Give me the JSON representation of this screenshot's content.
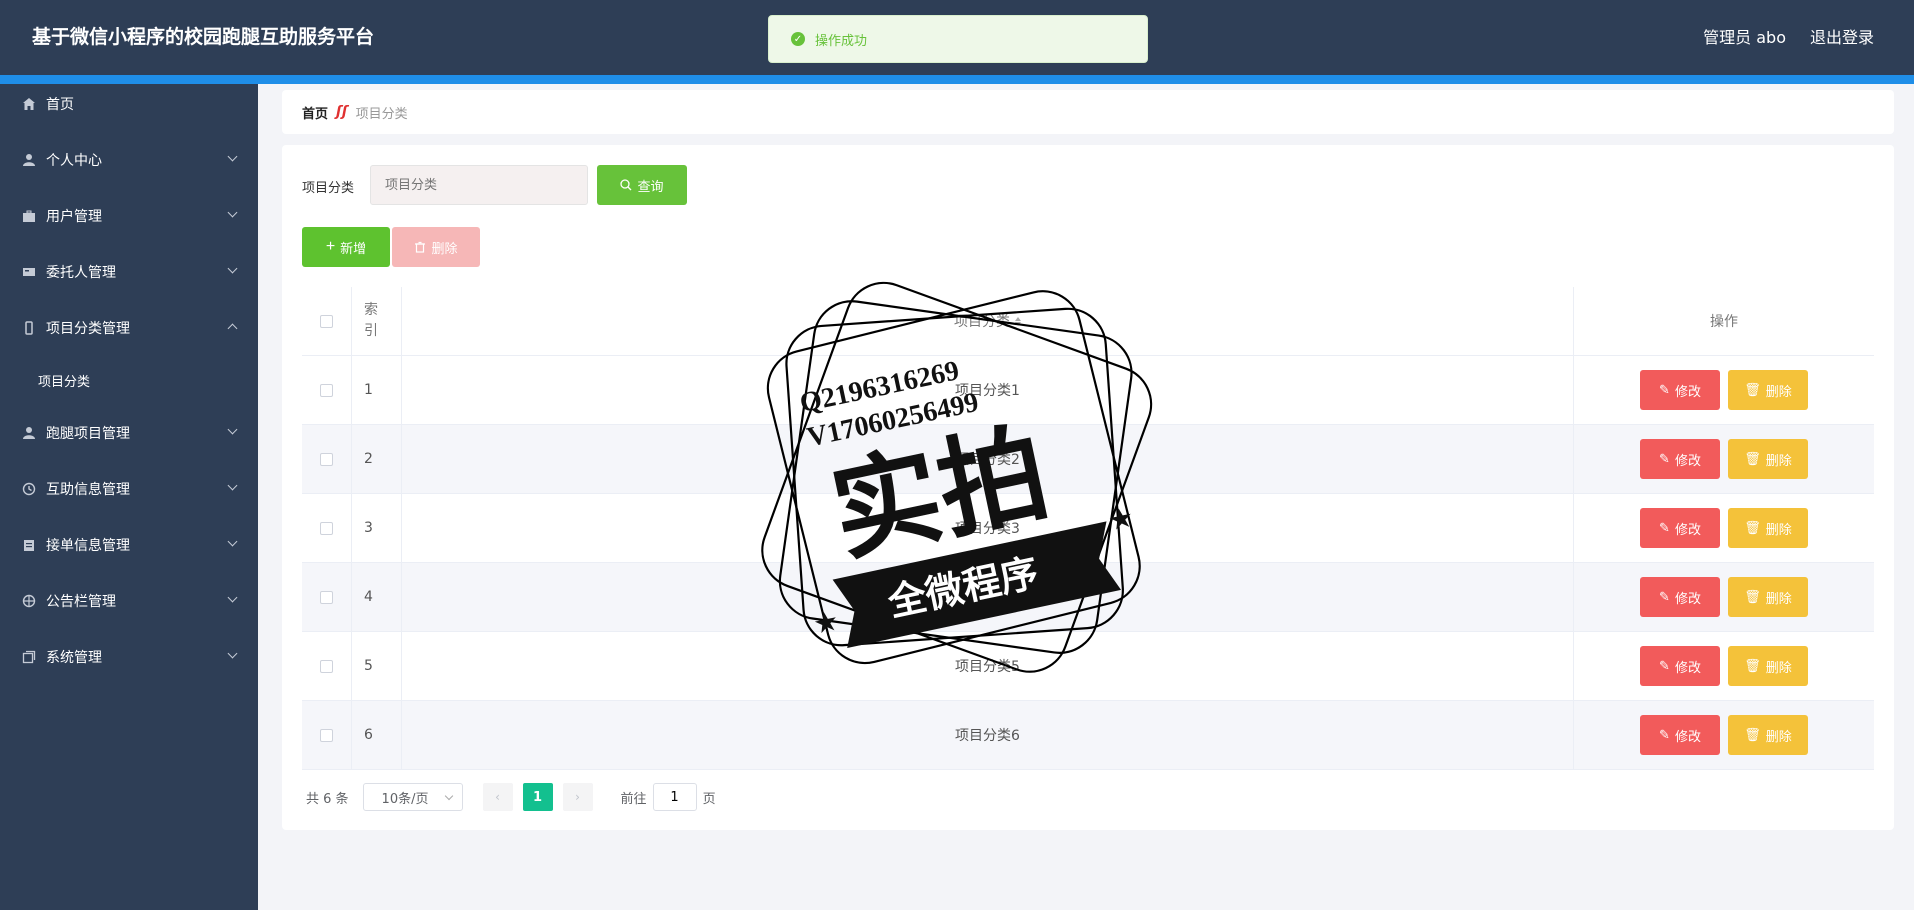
{
  "app": {
    "title": "基于微信小程序的校园跑腿互助服务平台"
  },
  "header": {
    "user": "管理员 abo",
    "logout": "退出登录"
  },
  "toast": {
    "message": "操作成功"
  },
  "sidebar": {
    "items": [
      {
        "label": "首页",
        "icon": "home-icon"
      },
      {
        "label": "个人中心",
        "icon": "user-icon"
      },
      {
        "label": "用户管理",
        "icon": "briefcase-icon"
      },
      {
        "label": "委托人管理",
        "icon": "card-icon"
      },
      {
        "label": "项目分类管理",
        "icon": "phone-icon",
        "expanded": true
      },
      {
        "label": "跑腿项目管理",
        "icon": "person-icon"
      },
      {
        "label": "互助信息管理",
        "icon": "clock-icon"
      },
      {
        "label": "接单信息管理",
        "icon": "clipboard-icon"
      },
      {
        "label": "公告栏管理",
        "icon": "target-icon"
      },
      {
        "label": "系统管理",
        "icon": "copy-icon"
      }
    ],
    "sub_item": "项目分类"
  },
  "breadcrumb": {
    "home": "首页",
    "current": "项目分类"
  },
  "search": {
    "label": "项目分类",
    "placeholder": "项目分类",
    "button": "查询"
  },
  "actions": {
    "add": "新增",
    "delete": "删除"
  },
  "table": {
    "headers": {
      "index": "索引",
      "name": "项目分类",
      "ops": "操作"
    },
    "rows": [
      {
        "index": "1",
        "name": "项目分类1"
      },
      {
        "index": "2",
        "name": "项目分类2"
      },
      {
        "index": "3",
        "name": "项目分类3"
      },
      {
        "index": "4",
        "name": "项目分类4"
      },
      {
        "index": "5",
        "name": "项目分类5"
      },
      {
        "index": "6",
        "name": "项目分类6"
      }
    ],
    "edit_label": "修改",
    "delete_label": "删除"
  },
  "pagination": {
    "total": "共 6 条",
    "page_size": "10条/页",
    "current": "1",
    "goto_prefix": "前往",
    "goto_value": "1",
    "goto_suffix": "页"
  },
  "watermark": {
    "line1": "Q2196316269",
    "line2": "V17060256499",
    "main": "实拍",
    "banner": "全微程序"
  },
  "colors": {
    "header": "#2e3e56",
    "accent": "#1f8ee8",
    "success": "#67c23a",
    "danger": "#f25b5b",
    "warning": "#f4c23a",
    "page_active": "#13c08f"
  }
}
